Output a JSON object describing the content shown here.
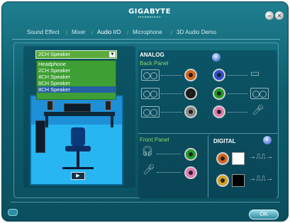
{
  "app": {
    "brand": "GIGABYTE",
    "brand_sub": "TECHNOLOGY"
  },
  "tabs": [
    {
      "label": "Sound Effect"
    },
    {
      "label": "Mixer"
    },
    {
      "label": "Audio I/O"
    },
    {
      "label": "Microphone"
    },
    {
      "label": "3D Audio Demo"
    }
  ],
  "speaker_config": {
    "selected": "2CH Speaker",
    "options": [
      "Headphone",
      "2CH Speaker",
      "4CH Speaker",
      "6CH Speaker",
      "8CH Speaker"
    ],
    "highlighted": "8CH Speaker"
  },
  "analog": {
    "title": "ANALOG",
    "back_panel": "Back Panel",
    "front_panel": "Front Panel"
  },
  "digital": {
    "title": "DIGITAL"
  },
  "jacks": {
    "back_left": [
      "#d5641c",
      "#1a1a1a",
      "#8a8a8a"
    ],
    "back_right": [
      "#2d4ed8",
      "#1f9a2a",
      "#e07ab0"
    ],
    "front": [
      "#1f9a2a",
      "#e07ab0"
    ],
    "digital": [
      "#d5641c",
      "#d0a020"
    ]
  },
  "buttons": {
    "ok": "OK",
    "play": "▶"
  },
  "window": {
    "minimize": "–",
    "close": "×",
    "info": "i"
  }
}
